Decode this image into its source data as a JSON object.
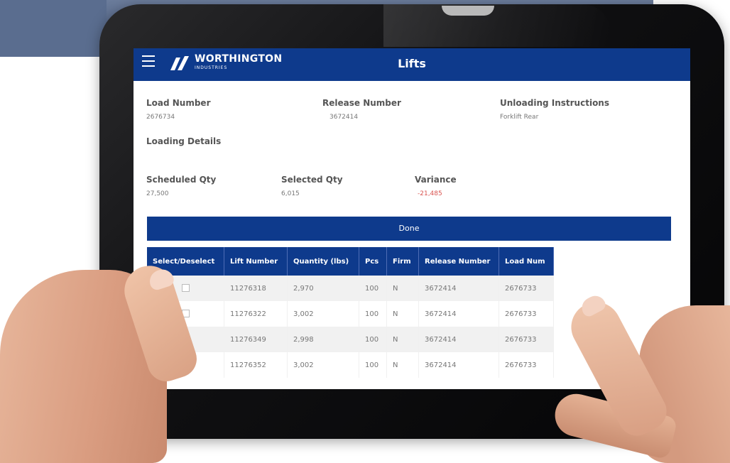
{
  "app": {
    "brand": "WORTHINGTON",
    "brand_sub": "INDUSTRIES",
    "title": "Lifts"
  },
  "details": {
    "load_number_label": "Load Number",
    "load_number": "2676734",
    "release_number_label": "Release Number",
    "release_number": "3672414",
    "unloading_label": "Unloading Instructions",
    "unloading_value": "Forklift Rear",
    "loading_details_label": "Loading Details",
    "scheduled_qty_label": "Scheduled Qty",
    "scheduled_qty": "27,500",
    "selected_qty_label": "Selected Qty",
    "selected_qty": "6,015",
    "variance_label": "Variance",
    "variance": "-21,485"
  },
  "done_label": "Done",
  "table": {
    "headers": [
      "Select/Deselect",
      "Lift Number",
      "Quantity (lbs)",
      "Pcs",
      "Firm",
      "Release Number",
      "Load Num"
    ],
    "rows": [
      {
        "lift": "11276318",
        "qty": "2,970",
        "pcs": "100",
        "firm": "N",
        "release": "3672414",
        "load": "2676733"
      },
      {
        "lift": "11276322",
        "qty": "3,002",
        "pcs": "100",
        "firm": "N",
        "release": "3672414",
        "load": "2676733"
      },
      {
        "lift": "11276349",
        "qty": "2,998",
        "pcs": "100",
        "firm": "N",
        "release": "3672414",
        "load": "2676733"
      },
      {
        "lift": "11276352",
        "qty": "3,002",
        "pcs": "100",
        "firm": "N",
        "release": "3672414",
        "load": "2676733"
      }
    ]
  },
  "colors": {
    "primary": "#0e3a8c",
    "variance": "#d9534f"
  },
  "icons": {
    "menu": "hamburger-menu-icon",
    "logo": "worthington-logo-mark"
  }
}
